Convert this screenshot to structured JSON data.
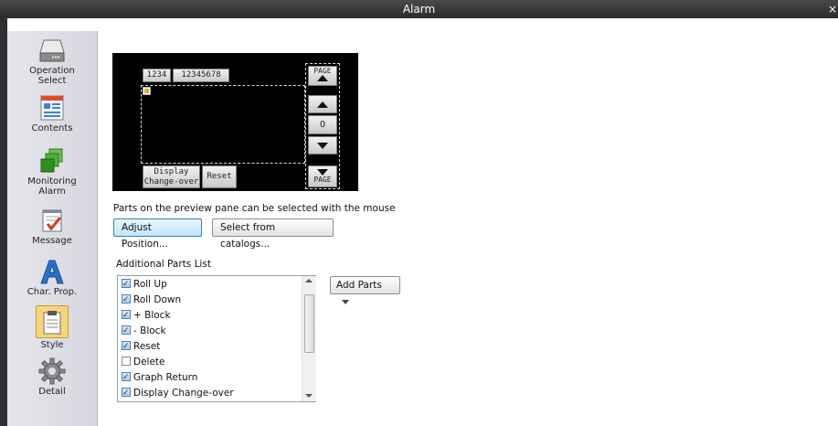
{
  "window": {
    "title": "Alarm",
    "close_glyph": "×"
  },
  "sidebar": {
    "items": [
      {
        "label_lines": [
          "Operation",
          "Select"
        ],
        "icon": "drive-icon"
      },
      {
        "label_lines": [
          "Contents"
        ],
        "icon": "contents-icon"
      },
      {
        "label_lines": [
          "Monitoring",
          "Alarm"
        ],
        "icon": "monitoring-icon"
      },
      {
        "label_lines": [
          "Message"
        ],
        "icon": "message-icon"
      },
      {
        "label_lines": [
          "Char. Prop."
        ],
        "icon": "char-prop-icon"
      },
      {
        "label_lines": [
          "Style"
        ],
        "icon": "style-icon"
      },
      {
        "label_lines": [
          "Detail"
        ],
        "icon": "gear-icon"
      }
    ]
  },
  "preview": {
    "date_chip": "1234",
    "time_chip": "12345678",
    "page_label": "PAGE",
    "center_button": "O",
    "display_changeover_lines": [
      "Display",
      "Change-over"
    ],
    "reset_label": "Reset"
  },
  "hint_text": "Parts on the preview pane can be selected with the mouse",
  "buttons": {
    "adjust_position": "Adjust Position...",
    "select_catalogs": "Select from catalogs...",
    "add_parts": "Add Parts"
  },
  "parts_list": {
    "title": "Additional Parts List",
    "items": [
      {
        "label": "Roll Up",
        "checked": true
      },
      {
        "label": "Roll Down",
        "checked": true
      },
      {
        "label": "+ Block",
        "checked": true
      },
      {
        "label": "- Block",
        "checked": true
      },
      {
        "label": "Reset",
        "checked": true
      },
      {
        "label": "Delete",
        "checked": false
      },
      {
        "label": "Graph Return",
        "checked": true
      },
      {
        "label": "Display Change-over",
        "checked": true
      }
    ]
  },
  "colors": {
    "accent": "#3c7fb1",
    "title_bar": "#2b2b2b",
    "sidebar": "#dedfe6"
  }
}
